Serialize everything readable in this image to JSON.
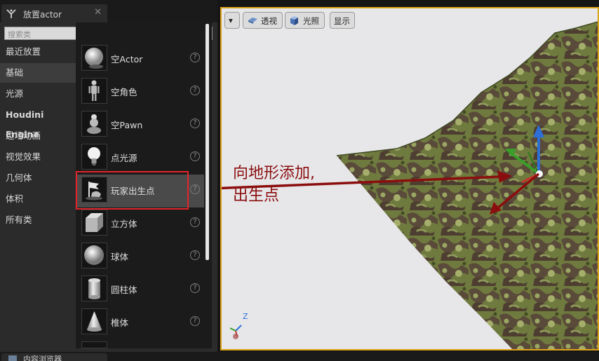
{
  "panel": {
    "tab_title": "放置actor",
    "close_glyph": "✕",
    "search_placeholder": "搜索类",
    "categories": [
      {
        "label": "最近放置",
        "selected": false,
        "bold": false
      },
      {
        "label": "基础",
        "selected": true,
        "bold": false
      },
      {
        "label": "光源",
        "selected": false,
        "bold": false
      },
      {
        "label": "Houdini Engine",
        "selected": false,
        "bold": true
      },
      {
        "label": "过场动画",
        "selected": false,
        "bold": false
      },
      {
        "label": "视觉效果",
        "selected": false,
        "bold": false
      },
      {
        "label": "几何体",
        "selected": false,
        "bold": false
      },
      {
        "label": "体积",
        "selected": false,
        "bold": false
      },
      {
        "label": "所有类",
        "selected": false,
        "bold": false
      }
    ],
    "items": [
      {
        "label": "空Actor",
        "icon": "sphere-icon"
      },
      {
        "label": "空角色",
        "icon": "character-icon"
      },
      {
        "label": "空Pawn",
        "icon": "pawn-icon"
      },
      {
        "label": "点光源",
        "icon": "light-bulb-icon"
      },
      {
        "label": "玩家出生点",
        "icon": "player-start-icon",
        "highlighted": true
      },
      {
        "label": "立方体",
        "icon": "cube-icon"
      },
      {
        "label": "球体",
        "icon": "sphere-icon"
      },
      {
        "label": "圆柱体",
        "icon": "cylinder-icon"
      },
      {
        "label": "椎体",
        "icon": "cone-icon"
      }
    ],
    "help_glyph": "?"
  },
  "viewport": {
    "menu_button": "▾",
    "perspective_label": "透视",
    "lit_label": "光照",
    "show_label": "显示",
    "annotation_line1": "向地形添加,",
    "annotation_line2": "出生点",
    "mini_axis_z": "Z"
  },
  "bottom": {
    "tab_title": "内容浏览器"
  },
  "colors": {
    "highlight_box": "#e2262a",
    "annotation": "#8b0e0e",
    "viewport_border": "#e0a21a"
  }
}
